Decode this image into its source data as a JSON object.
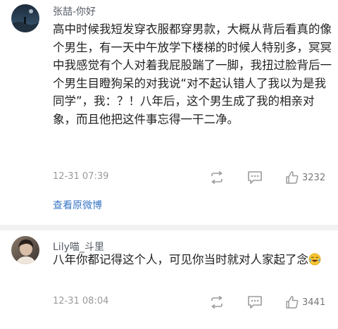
{
  "comments": [
    {
      "username": "张喆-你好",
      "text": "高中时候我短发穿衣服都穿男款，大概从背后看真的像个男生，有一天中午放学下楼梯的时候人特别多，冥冥中我感觉有个人对着我屁股踹了一脚，我扭过脸背后一个男生目瞪狗呆的对我说“对不起认错人了我以为是我同学”，我：？！八年后，这个男生成了我的相亲对象，而且他把这件事忘得一干二净。",
      "timestamp": "12-31 07:39",
      "likes": "3232",
      "avatar_icon": "night-scene-avatar",
      "link_label": "查看原微博"
    },
    {
      "username": "Lily喵_斗里",
      "text": "八年你都记得这个人，可见你当时就对人家起了念",
      "emoji_icon": "tears-of-joy-emoji",
      "timestamp": "12-31 08:04",
      "likes": "3441",
      "avatar_icon": "photo-avatar"
    }
  ],
  "colors": {
    "link": "#3a77c4",
    "meta_text": "#9a9a9a",
    "icon_gray": "#9b9b9b",
    "divider": "#f2f2f2"
  }
}
